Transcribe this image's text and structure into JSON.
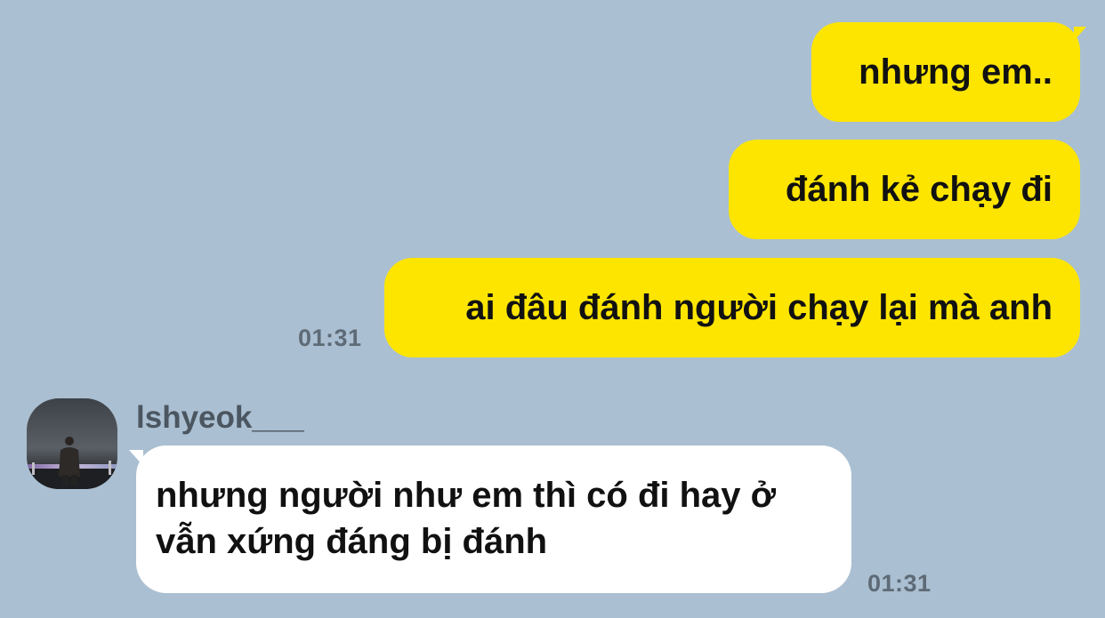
{
  "messages": {
    "out1": "nhưng em..",
    "out2": "đánh kẻ chạy đi",
    "out3": "ai đâu đánh người chạy lại mà anh",
    "out_time": "01:31",
    "in_sender": "lshyeok___",
    "in_text": "nhưng người như em thì có đi hay ở vẫn xứng đáng bị đánh",
    "in_time": "01:31"
  },
  "colors": {
    "background": "#aabfd1",
    "outgoing_bubble": "#fee500",
    "incoming_bubble": "#ffffff",
    "timestamp": "#5e6b77"
  },
  "icons": {
    "avatar": "profile-photo"
  }
}
